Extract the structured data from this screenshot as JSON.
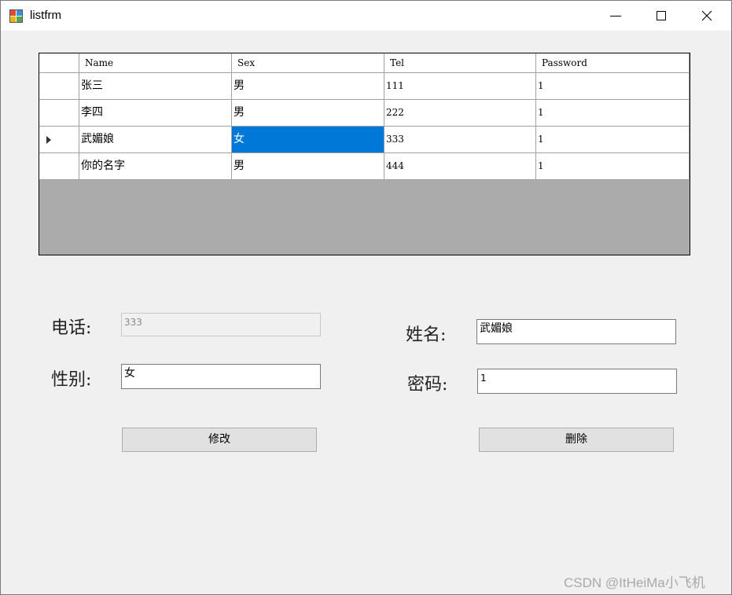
{
  "window": {
    "title": "listfrm"
  },
  "grid": {
    "columns": [
      "Name",
      "Sex",
      "Tel",
      "Password"
    ],
    "rows": [
      {
        "name": "张三",
        "sex": "男",
        "tel": "111",
        "password": "1"
      },
      {
        "name": "李四",
        "sex": "男",
        "tel": "222",
        "password": "1"
      },
      {
        "name": "武媚娘",
        "sex": "女",
        "tel": "333",
        "password": "1"
      },
      {
        "name": "你的名字",
        "sex": "男",
        "tel": "444",
        "password": "1"
      }
    ],
    "current_row": 2,
    "selected_cell": "Sex",
    "selection_color": "#0078d7"
  },
  "form": {
    "phone_label": "电话:",
    "phone_value": "333",
    "gender_label": "性别:",
    "gender_value": "女",
    "name_label": "姓名:",
    "name_value": "武媚娘",
    "password_label": "密码:",
    "password_value": "1"
  },
  "buttons": {
    "modify": "修改",
    "delete": "删除"
  },
  "watermark": "CSDN @ItHeiMa小飞机"
}
